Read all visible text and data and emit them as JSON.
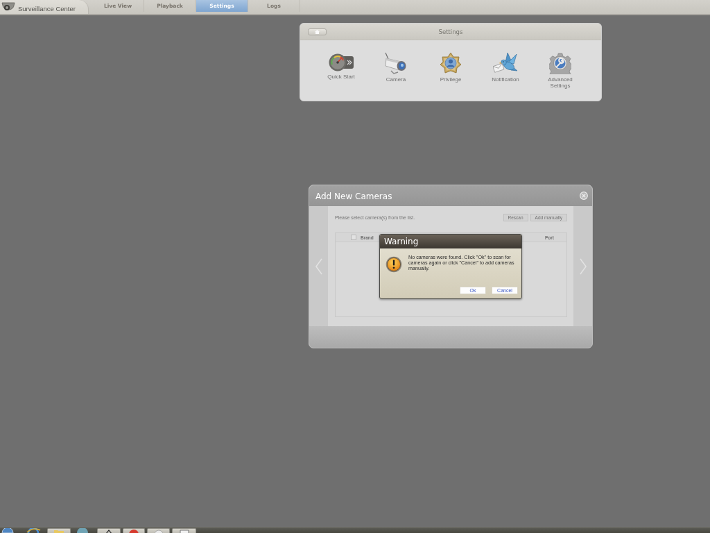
{
  "app": {
    "title": "Surveillance Center"
  },
  "tabs": [
    {
      "label": "Live View",
      "selected": false
    },
    {
      "label": "Playback",
      "selected": false
    },
    {
      "label": "Settings",
      "selected": true
    },
    {
      "label": "Logs",
      "selected": false
    }
  ],
  "settings_panel": {
    "title": "Settings",
    "items": [
      {
        "label": "Quick Start",
        "kind": "gauge"
      },
      {
        "label": "Camera",
        "kind": "camera"
      },
      {
        "label": "Privilege",
        "kind": "badge"
      },
      {
        "label": "Notification",
        "kind": "bird"
      },
      {
        "label": "Advanced Settings",
        "kind": "gear"
      }
    ]
  },
  "add_cameras_dialog": {
    "title": "Add New Cameras",
    "instruction": "Please select camera(s) from the list.",
    "buttons": [
      "Rescan",
      "Add manually"
    ],
    "table": {
      "select_all_checked": false,
      "columns": [
        "Brand",
        "Port"
      ]
    }
  },
  "warning_dialog": {
    "title": "Warning",
    "message": "No cameras were found. Click \"Ok\" to scan for cameras again or click \"Cancel\" to add cameras manually.",
    "buttons": [
      "Ok",
      "Cancel"
    ]
  }
}
